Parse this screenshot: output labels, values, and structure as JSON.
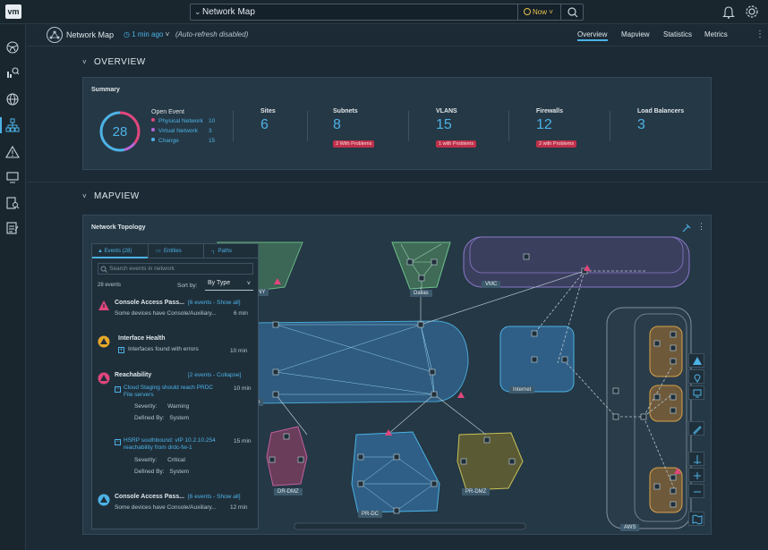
{
  "app": {
    "logo": "vm",
    "search_query": "Network Map",
    "time_selector": "Now",
    "icons": [
      "bell-icon",
      "gear-icon"
    ]
  },
  "sidebar": {
    "items": [
      "network-globe-icon",
      "search-analytics-icon",
      "globe-icon",
      "topology-icon",
      "alert-icon",
      "monitor-icon",
      "search-report-icon",
      "checklist-icon"
    ],
    "active_index": 3
  },
  "subheader": {
    "title": "Network Map",
    "refreshed": "1 min ago",
    "auto_refresh": "(Auto-refresh disabled)",
    "tabs": [
      "Overview",
      "Mapview",
      "Statistics",
      "Metrics"
    ],
    "active_tab": "Overview"
  },
  "overview": {
    "section_title": "OVERVIEW",
    "summary_title": "Summary",
    "open_event_total": "28",
    "open_event_title": "Open Event",
    "open_events": [
      {
        "label": "Physical Network",
        "count": "10",
        "color": "#e0467c"
      },
      {
        "label": "Virtual Network",
        "count": "3",
        "color": "#b765d8"
      },
      {
        "label": "Change",
        "count": "15",
        "color": "#4cb2e6"
      }
    ],
    "metrics": [
      {
        "label": "Sites",
        "value": "6",
        "badge": ""
      },
      {
        "label": "Subnets",
        "value": "8",
        "badge": "2 With Problems"
      },
      {
        "label": "VLANS",
        "value": "15",
        "badge": "1 with Problems"
      },
      {
        "label": "Firewalls",
        "value": "12",
        "badge": "2 with Problems"
      },
      {
        "label": "Load Balancers",
        "value": "3",
        "badge": ""
      }
    ]
  },
  "mapview": {
    "section_title": "MAPVIEW",
    "panel_title": "Network Topology",
    "panel_tabs": [
      "Events (28)",
      "Entities",
      "Paths"
    ],
    "search_placeholder": "Search events in network",
    "event_count": "28 events",
    "sort_label": "Sort by:",
    "sort_value": "By Type",
    "events": [
      {
        "title": "Console Access Pass...",
        "link": "[6 events - Show all]",
        "desc": "Some devices have Console/Auxiliary...",
        "time": "6 min",
        "severity": "critical"
      },
      {
        "title": "Interface Health",
        "link": "",
        "desc": "Interfaces found with errors",
        "time": "10 min",
        "severity": "warning"
      },
      {
        "title": "Reachability",
        "link": "[2 events - Collapse]",
        "desc": "",
        "time": "",
        "severity": "critical"
      },
      {
        "title": "Console Access Pass...",
        "link": "[6 events - Show all]",
        "desc": "Some devices have Console/Auxiliary...",
        "time": "12 min",
        "severity": "info"
      }
    ],
    "sub_events": [
      {
        "title": "Cloud Staging should reach PRDC",
        "title2": "File servers",
        "time": "10 min",
        "severity_label": "Severity:",
        "severity": "Warning",
        "defined_label": "Defined By:",
        "defined_by": "System"
      },
      {
        "title": "HSRP southbound: vIP 10.2.10.254",
        "title2": "reachability from drdc-fw-1",
        "time": "15 min",
        "severity_label": "Severity:",
        "severity": "Critical",
        "defined_label": "Defined By:",
        "defined_by": "System"
      }
    ],
    "map_labels": [
      "NY",
      "Dallas",
      "VMC",
      "Internet",
      "AWS",
      "DR-DMZ",
      "PR-DMZ",
      "PR-DC",
      "e"
    ]
  }
}
